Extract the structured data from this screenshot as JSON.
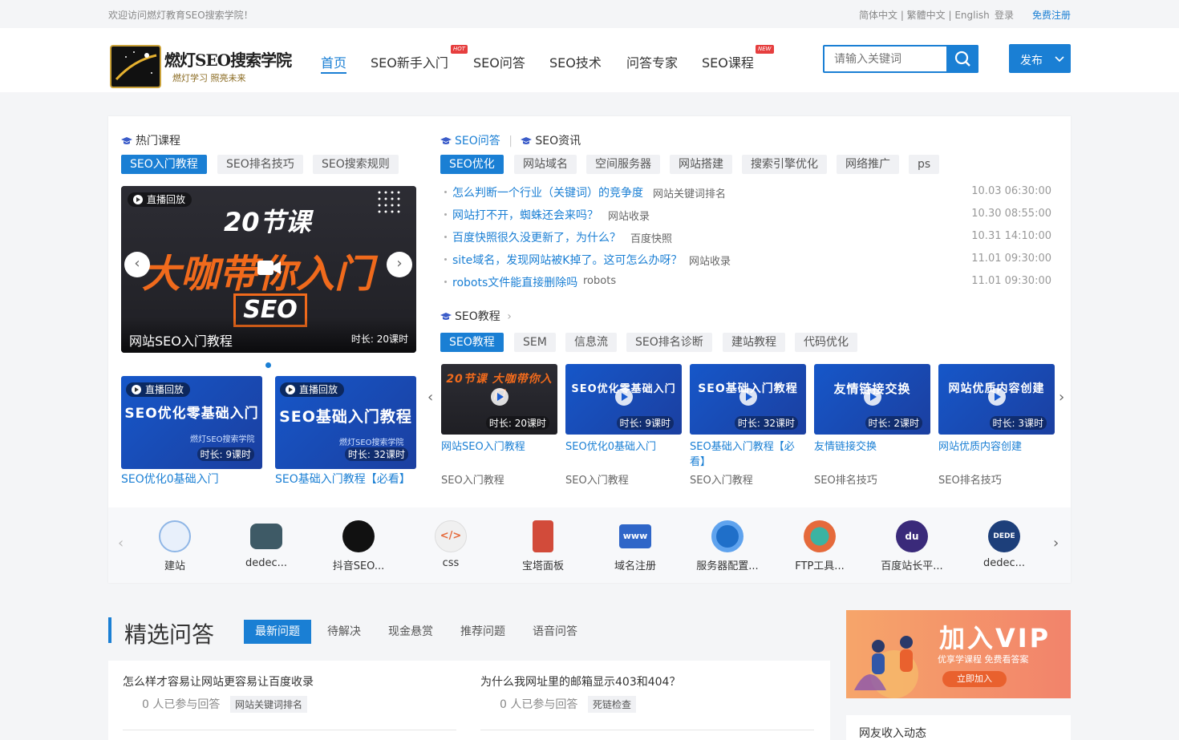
{
  "topbar": {
    "welcome": "欢迎访问燃灯教育SEO搜索学院！",
    "languages": "简体中文 | 繁體中文 | English",
    "login": "登录",
    "register": "免费注册"
  },
  "logo": {
    "name": "燃灯SEO搜索学院",
    "slogan": "燃灯学习 照亮未来"
  },
  "nav": {
    "items": [
      {
        "label": "首页",
        "active": true
      },
      {
        "label": "SEO新手入门",
        "tag": "HOT"
      },
      {
        "label": "SEO问答"
      },
      {
        "label": "SEO技术"
      },
      {
        "label": "问答专家"
      },
      {
        "label": "SEO课程",
        "tag": "NEW"
      }
    ]
  },
  "search": {
    "placeholder": "请输入关键词"
  },
  "publish": {
    "label": "发布"
  },
  "hot_courses": {
    "title": "热门课程",
    "tabs": [
      "SEO入门教程",
      "SEO排名技巧",
      "SEO搜索规则"
    ],
    "slide": {
      "badge": "直播回放",
      "headline1": "20节课",
      "headline2": "大咖带你入门",
      "headline3": "SEO",
      "caption": "网站SEO入门教程",
      "duration": "时长: 20课时"
    },
    "cards": [
      {
        "badge": "直播回放",
        "image_text": "SEO优化零基础入门",
        "watermark": "燃灯SEO搜索学院",
        "duration": "时长: 9课时",
        "title": "SEO优化0基础入门"
      },
      {
        "badge": "直播回放",
        "image_text": "SEO基础入门教程",
        "watermark": "燃灯SEO搜索学院",
        "duration": "时长: 32课时",
        "title": "SEO基础入门教程【必看】"
      }
    ]
  },
  "qa_news": {
    "title_a": "SEO问答",
    "title_b": "SEO资讯",
    "tabs": [
      "SEO优化",
      "网站域名",
      "空间服务器",
      "网站搭建",
      "搜索引擎优化",
      "网络推广",
      "ps"
    ],
    "rows": [
      {
        "title": "怎么判断一个行业（关键词）的竞争度",
        "category": "网站关键词排名",
        "date": "10.03 06:30:00"
      },
      {
        "title": "网站打不开，蜘蛛还会来吗？",
        "category": "网站收录",
        "date": "10.30 08:55:00"
      },
      {
        "title": "百度快照很久没更新了，为什么？",
        "category": "百度快照",
        "date": "10.31 14:10:00"
      },
      {
        "title": "site域名，发现网站被K掉了。这可怎么办呀？",
        "category": "网站收录",
        "date": "11.01 09:30:00"
      },
      {
        "title": "robots文件能直接删除吗",
        "category": "robots",
        "date": "11.01 09:30:00"
      }
    ]
  },
  "tutorials": {
    "title": "SEO教程",
    "tabs": [
      "SEO教程",
      "SEM",
      "信息流",
      "SEO排名诊断",
      "建站教程",
      "代码优化"
    ],
    "cards": [
      {
        "image_text": "20节课 大咖带你入门",
        "duration": "时长: 20课时",
        "title": "网站SEO入门教程",
        "category": "SEO入门教程"
      },
      {
        "image_text": "SEO优化零基础入门",
        "duration": "时长: 9课时",
        "title": "SEO优化0基础入门",
        "category": "SEO入门教程"
      },
      {
        "image_text": "SEO基础入门教程",
        "duration": "时长: 32课时",
        "title": "SEO基础入门教程【必看】",
        "category": "SEO入门教程"
      },
      {
        "image_text": "友情链接交换",
        "duration": "时长: 2课时",
        "title": "友情链接交换",
        "category": "SEO排名技巧"
      },
      {
        "image_text": "网站优质内容创建",
        "duration": "时长: 3课时",
        "title": "网站优质内容创建",
        "category": "SEO排名技巧"
      }
    ]
  },
  "tools": [
    {
      "label": "建站",
      "color": "#8fb6e6"
    },
    {
      "label": "dedec...",
      "color": "#3e5a66"
    },
    {
      "label": "抖音SEO...",
      "color": "#111111"
    },
    {
      "label": "css",
      "color": "#f0f0f0"
    },
    {
      "label": "宝塔面板",
      "color": "#d24b3a"
    },
    {
      "label": "域名注册",
      "color": "#2f66c8"
    },
    {
      "label": "服务器配置...",
      "color": "#1f6fc9"
    },
    {
      "label": "FTP工具...",
      "color": "#e56a3b"
    },
    {
      "label": "百度站长平...",
      "color": "#3a2a7a"
    },
    {
      "label": "dedec...",
      "color": "#1d3f7a"
    }
  ],
  "qa": {
    "title": "精选问答",
    "tabs": [
      "最新问题",
      "待解决",
      "现金悬赏",
      "推荐问题",
      "语音问答"
    ],
    "cards": [
      {
        "title": "怎么样才容易让网站更容易让百度收录",
        "meta": "0 人已参与回答",
        "tag": "网站关键词排名"
      },
      {
        "title": "为什么我网址里的邮箱显示403和404？",
        "meta": "0 人已参与回答",
        "tag": "死链检查"
      }
    ]
  },
  "vip": {
    "title": "加入VIP",
    "subtitle": "优享学课程  免费看答案",
    "button": "立即加入"
  },
  "friends": {
    "title": "网友收入动态"
  },
  "colors": {
    "accent": "#1a7fd4",
    "hot": "#e63e3e"
  }
}
